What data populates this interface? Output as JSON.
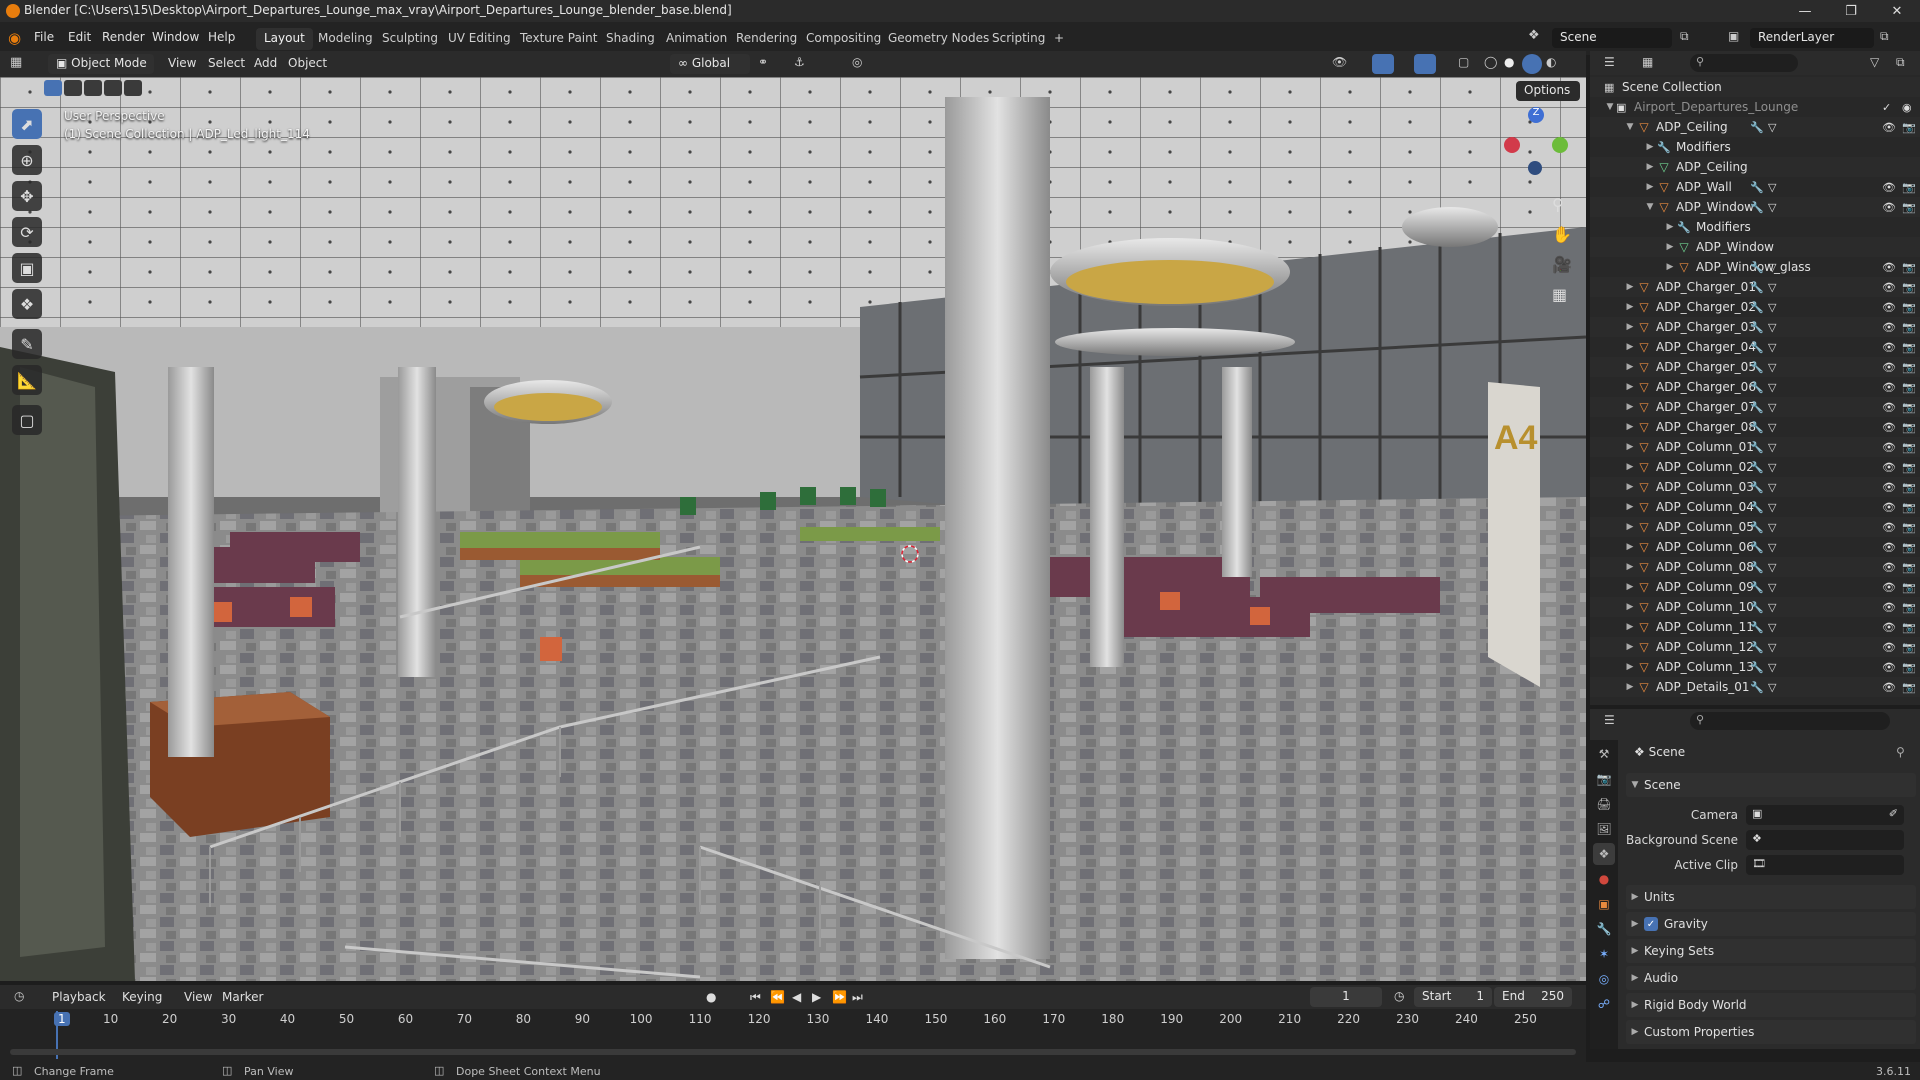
{
  "titlebar": {
    "title": "Blender [C:\\Users\\15\\Desktop\\Airport_Departures_Lounge_max_vray\\Airport_Departures_Lounge_blender_base.blend]"
  },
  "menu": {
    "items": [
      "File",
      "Edit",
      "Render",
      "Window",
      "Help"
    ],
    "workspaces": [
      "Layout",
      "Modeling",
      "Sculpting",
      "UV Editing",
      "Texture Paint",
      "Shading",
      "Animation",
      "Rendering",
      "Compositing",
      "Geometry Nodes",
      "Scripting"
    ],
    "active_workspace": "Layout",
    "add_tab": "+",
    "scene": "Scene",
    "render_layer": "RenderLayer"
  },
  "viewport_header": {
    "mode": "Object Mode",
    "menus": [
      "View",
      "Select",
      "Add",
      "Object"
    ],
    "orientation": "Global",
    "options": "Options"
  },
  "viewport": {
    "perspective": "User Perspective",
    "collection_info": "(1) Scene Collection | ADP_Led_light_114",
    "gate_sign": "A4",
    "gizmo": {
      "z": "Z"
    }
  },
  "outliner": {
    "root": "Scene Collection",
    "collection": "Airport_Departures_Lounge",
    "items": [
      {
        "label": "ADP_Ceiling",
        "indent": 1,
        "expanded": true,
        "type": "object"
      },
      {
        "label": "Modifiers",
        "indent": 2,
        "expanded": false,
        "type": "modifier"
      },
      {
        "label": "ADP_Ceiling",
        "indent": 2,
        "expanded": false,
        "type": "mesh"
      },
      {
        "label": "ADP_Wall",
        "indent": 2,
        "expanded": false,
        "type": "object"
      },
      {
        "label": "ADP_Window",
        "indent": 2,
        "expanded": true,
        "type": "object"
      },
      {
        "label": "Modifiers",
        "indent": 3,
        "expanded": false,
        "type": "modifier"
      },
      {
        "label": "ADP_Window",
        "indent": 3,
        "expanded": false,
        "type": "mesh"
      },
      {
        "label": "ADP_Window_glass",
        "indent": 3,
        "expanded": false,
        "type": "object"
      },
      {
        "label": "ADP_Charger_01",
        "indent": 1,
        "expanded": false,
        "type": "object"
      },
      {
        "label": "ADP_Charger_02",
        "indent": 1,
        "expanded": false,
        "type": "object"
      },
      {
        "label": "ADP_Charger_03",
        "indent": 1,
        "expanded": false,
        "type": "object"
      },
      {
        "label": "ADP_Charger_04",
        "indent": 1,
        "expanded": false,
        "type": "object"
      },
      {
        "label": "ADP_Charger_05",
        "indent": 1,
        "expanded": false,
        "type": "object"
      },
      {
        "label": "ADP_Charger_06",
        "indent": 1,
        "expanded": false,
        "type": "object"
      },
      {
        "label": "ADP_Charger_07",
        "indent": 1,
        "expanded": false,
        "type": "object"
      },
      {
        "label": "ADP_Charger_08",
        "indent": 1,
        "expanded": false,
        "type": "object"
      },
      {
        "label": "ADP_Column_01",
        "indent": 1,
        "expanded": false,
        "type": "object"
      },
      {
        "label": "ADP_Column_02",
        "indent": 1,
        "expanded": false,
        "type": "object"
      },
      {
        "label": "ADP_Column_03",
        "indent": 1,
        "expanded": false,
        "type": "object"
      },
      {
        "label": "ADP_Column_04",
        "indent": 1,
        "expanded": false,
        "type": "object"
      },
      {
        "label": "ADP_Column_05",
        "indent": 1,
        "expanded": false,
        "type": "object"
      },
      {
        "label": "ADP_Column_06",
        "indent": 1,
        "expanded": false,
        "type": "object"
      },
      {
        "label": "ADP_Column_08",
        "indent": 1,
        "expanded": false,
        "type": "object"
      },
      {
        "label": "ADP_Column_09",
        "indent": 1,
        "expanded": false,
        "type": "object"
      },
      {
        "label": "ADP_Column_10",
        "indent": 1,
        "expanded": false,
        "type": "object"
      },
      {
        "label": "ADP_Column_11",
        "indent": 1,
        "expanded": false,
        "type": "object"
      },
      {
        "label": "ADP_Column_12",
        "indent": 1,
        "expanded": false,
        "type": "object"
      },
      {
        "label": "ADP_Column_13",
        "indent": 1,
        "expanded": false,
        "type": "object"
      },
      {
        "label": "ADP_Details_01",
        "indent": 1,
        "expanded": false,
        "type": "object"
      }
    ]
  },
  "properties": {
    "header": "Scene",
    "panel_scene": "Scene",
    "camera_label": "Camera",
    "background_scene_label": "Background Scene",
    "active_clip_label": "Active Clip",
    "subpanels": [
      "Units",
      "Gravity",
      "Keying Sets",
      "Audio",
      "Rigid Body World",
      "Custom Properties"
    ],
    "gravity_checked": true
  },
  "timeline": {
    "menus": [
      "Playback",
      "Keying",
      "View",
      "Marker"
    ],
    "current_frame": "1",
    "start_label": "Start",
    "start": "1",
    "end_label": "End",
    "end": "250",
    "ticks": [
      "1",
      "10",
      "20",
      "30",
      "40",
      "50",
      "60",
      "70",
      "80",
      "90",
      "100",
      "110",
      "120",
      "130",
      "140",
      "150",
      "160",
      "170",
      "180",
      "190",
      "200",
      "210",
      "220",
      "230",
      "240",
      "250"
    ]
  },
  "statusbar": {
    "hints": [
      "Change Frame",
      "Pan View",
      "Dope Sheet Context Menu"
    ],
    "version": "3.6.11"
  },
  "colors": {
    "accent": "#4772b3",
    "object_icon": "#e88a3e",
    "mesh_icon": "#6fd18f",
    "modifier_icon": "#7ab0ff"
  }
}
